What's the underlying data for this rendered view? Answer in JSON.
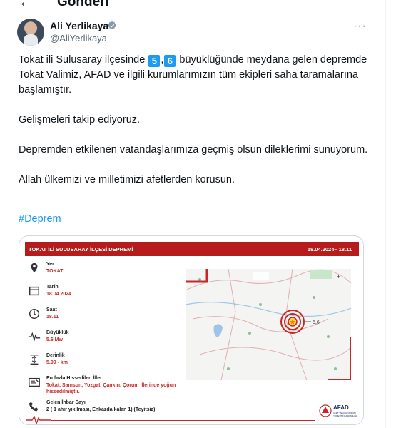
{
  "header": {
    "back_icon": "arrow-left-icon",
    "title": "Gönderi"
  },
  "author": {
    "name": "Ali Yerlikaya",
    "handle": "@AliYerlikaya",
    "verified_icon": "verified-badge-icon",
    "more_icon": "more-icon"
  },
  "tweet": {
    "line1_a": "Tokat ili Sulusaray ilçesinde ",
    "mag_digit1": "5",
    "mag_sep": ",",
    "mag_digit2": "6",
    "line1_b": " büyüklüğünde meydana gelen depremde Tokat Valimiz, AFAD ve ilgili kurumlarımızın tüm ekipleri saha taramalarına başlamıştır.",
    "para2": "Gelişmeleri takip ediyoruz.",
    "para3": "Depremden etkilenen vatandaşlarımıza geçmiş olsun dileklerimi sunuyorum.",
    "para4": "Allah ülkemizi ve milletimizi afetlerden korusun.",
    "hashtag": "#Deprem"
  },
  "card": {
    "title": "TOKAT İLİ SULUSARAY İLÇESİ DEPREMİ",
    "datetime": "18.04.2024– 18.11",
    "fields": [
      {
        "icon": "location-pin-icon",
        "label": "Yer",
        "value": "TOKAT"
      },
      {
        "icon": "calendar-icon",
        "label": "Tarih",
        "value": "18.04.2024"
      },
      {
        "icon": "clock-icon",
        "label": "Saat",
        "value": "18.11"
      },
      {
        "icon": "seismograph-icon",
        "label": "Büyüklük",
        "value": "5.6 Mw"
      },
      {
        "icon": "depth-icon",
        "label": "Derinlik",
        "value": "5.99 - km"
      },
      {
        "icon": "map-list-icon",
        "label": "En fazla Hissedilen İller",
        "value_line1": "Tokat, Samsun, Yozgat, Çankırı, Çorum illerinde yoğun",
        "value_line2": "hissedilmiştir."
      },
      {
        "icon": "phone-icon",
        "label": "Gelen İhbar Sayı",
        "value": "2 ( 1 ahır yıkılması, Enkazda kalan 1) (Teyitsiz)"
      }
    ],
    "map_magnitude_label": "5,6",
    "logo_text": "AFAD",
    "logo_sub": "AFET VE ACİL DURUM YÖNETİMİ BAŞKANLIĞI"
  },
  "colors": {
    "accent": "#1d9bf0",
    "card_red": "#b71c1c",
    "value_red": "#c62828",
    "text": "#0f1419",
    "muted": "#536471"
  }
}
